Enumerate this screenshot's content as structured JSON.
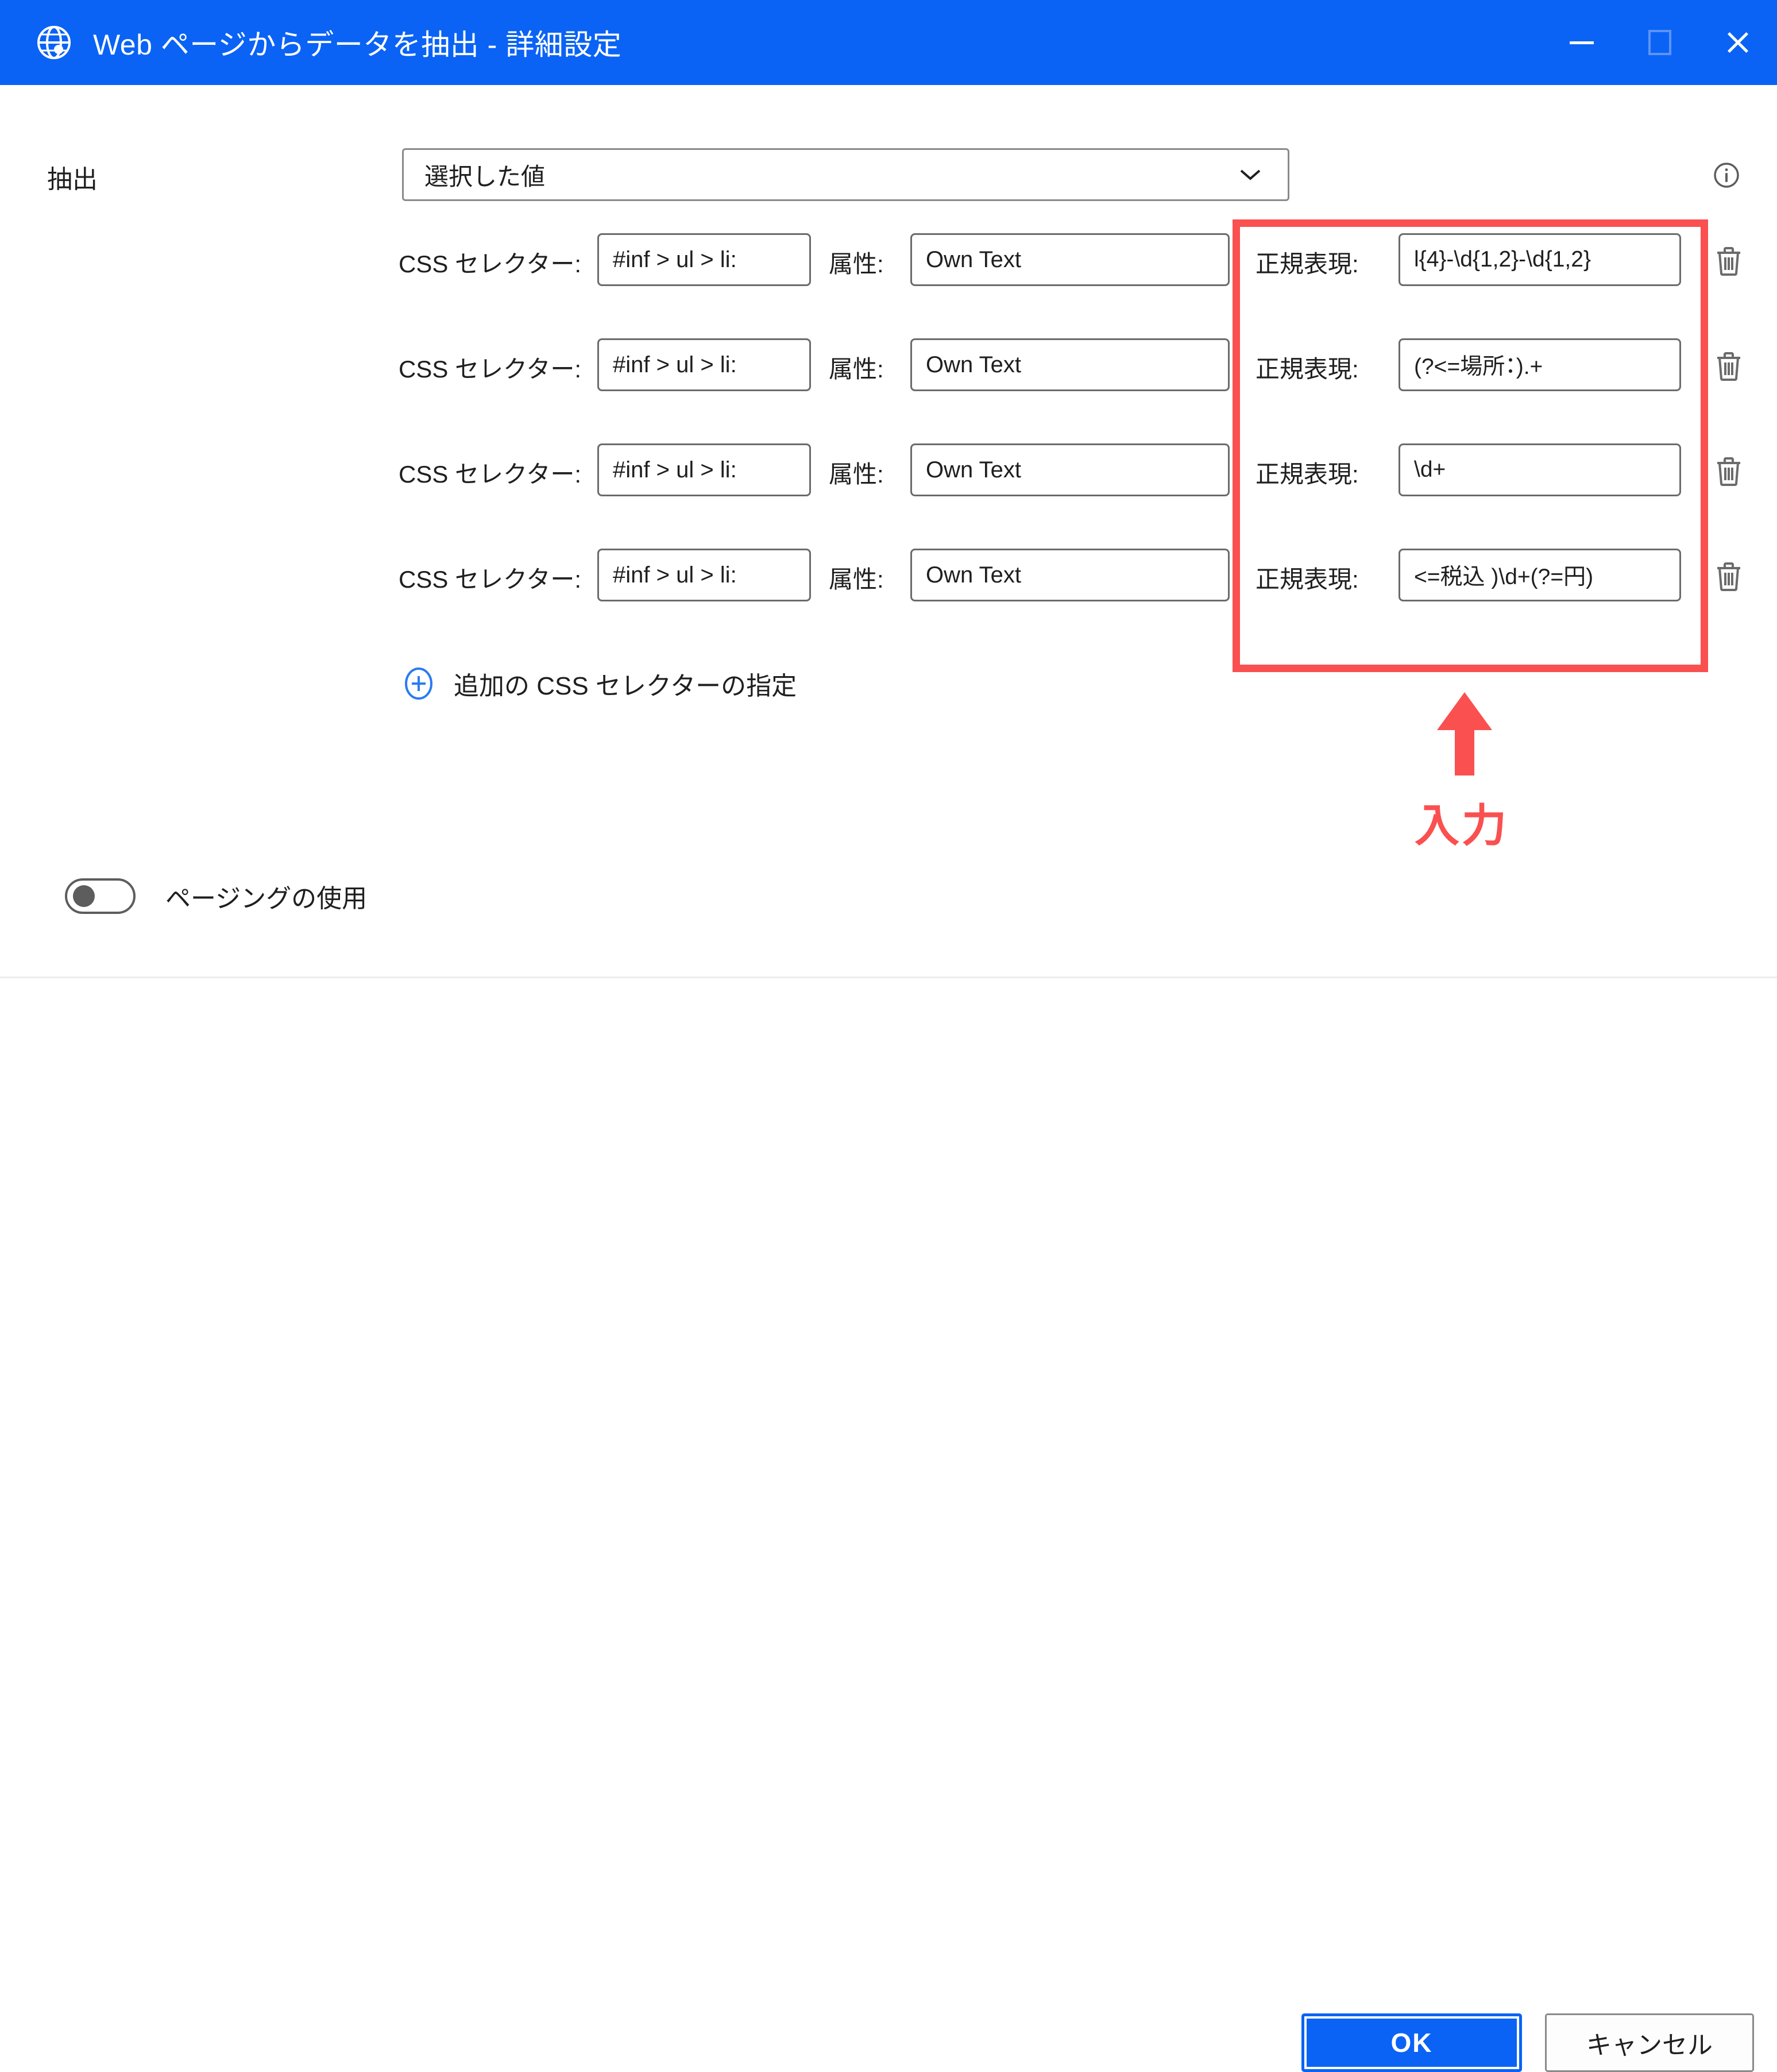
{
  "window": {
    "title": "Web ページからデータを抽出 - 詳細設定",
    "icon": "globe-icon",
    "controls": {
      "minimize": "minimize-icon",
      "maximize": "maximize-icon",
      "close": "close-icon"
    },
    "titlebar_color": "#0a63f5"
  },
  "extract": {
    "label": "抽出",
    "combo_value": "選択した値",
    "combo_icon": "chevron-down-icon",
    "info_icon": "info-icon"
  },
  "rows": [
    {
      "css_label": "CSS セレクター:",
      "css_value": "#inf > ul > li:",
      "attr_label": "属性:",
      "attr_value": "Own Text",
      "regex_label": "正規表現:",
      "regex_value": "l{4}-\\d{1,2}-\\d{1,2}",
      "delete_icon": "trash-icon"
    },
    {
      "css_label": "CSS セレクター:",
      "css_value": "#inf > ul > li:",
      "attr_label": "属性:",
      "attr_value": "Own Text",
      "regex_label": "正規表現:",
      "regex_value": "(?<=場所：).+",
      "delete_icon": "trash-icon"
    },
    {
      "css_label": "CSS セレクター:",
      "css_value": "#inf > ul > li:",
      "attr_label": "属性:",
      "attr_value": "Own Text",
      "regex_label": "正規表現:",
      "regex_value": "\\d+",
      "delete_icon": "trash-icon"
    },
    {
      "css_label": "CSS セレクター:",
      "css_value": "#inf > ul > li:",
      "attr_label": "属性:",
      "attr_value": "Own Text",
      "regex_label": "正規表現:",
      "regex_value": "<=税込 )\\d+(?=円)",
      "delete_icon": "trash-icon"
    }
  ],
  "add_selector": {
    "label": "追加の CSS セレクターの指定",
    "icon": "plus-circle-icon"
  },
  "annotation": {
    "text": "入力",
    "color": "#fa5050",
    "arrow_icon": "arrow-up-icon",
    "highlight_color": "#fa5050"
  },
  "paging": {
    "label": "ページングの使用",
    "state": "off"
  },
  "footer": {
    "ok_label": "OK",
    "cancel_label": "キャンセル",
    "ok_color": "#0a63f5"
  }
}
